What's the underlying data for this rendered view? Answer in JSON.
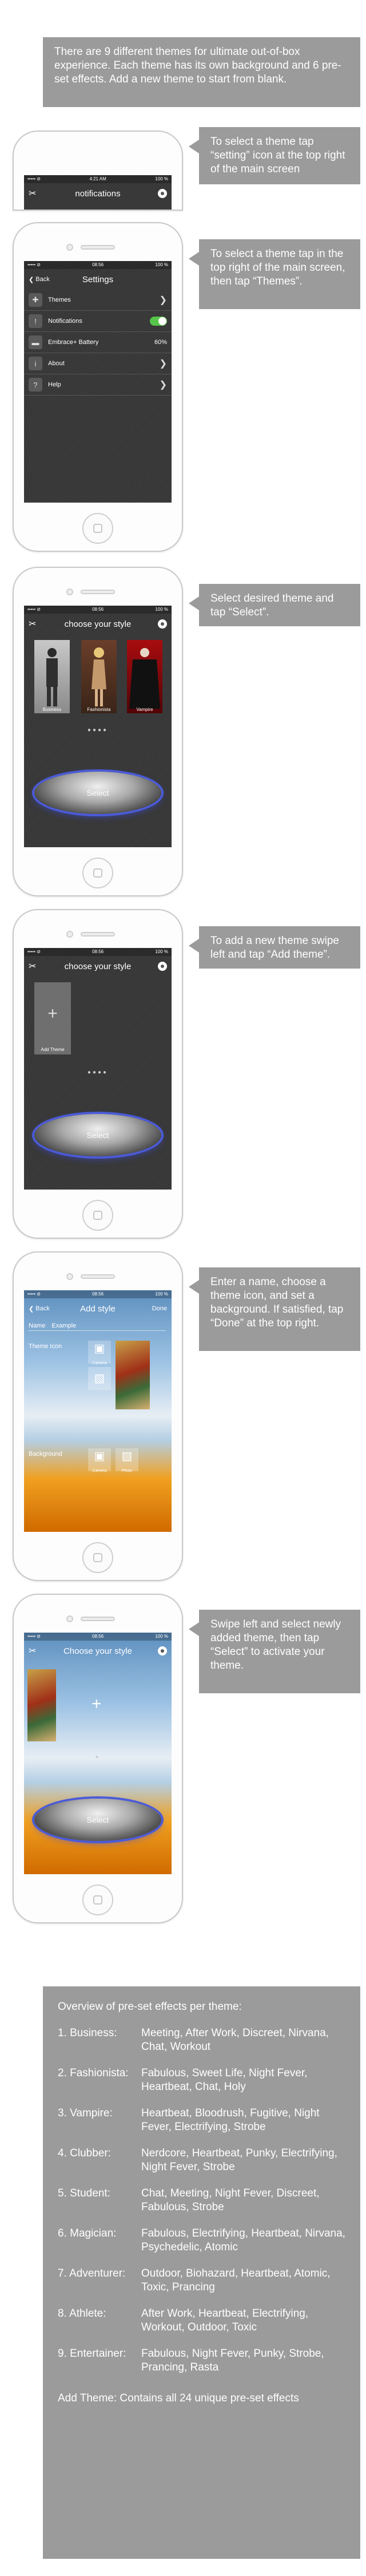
{
  "intro": "There are 9 different themes for ultimate out-of-box experience. Each theme has its own background and 6 pre-set effects. Add a new theme to start from blank.",
  "callouts": [
    "To select a theme tap “setting” icon at the top right of the main screen",
    "To select a theme tap   in the top right of the main screen, then tap “Themes”.",
    "Select desired theme and tap “Select”.",
    "To add a new theme swipe left and tap “Add theme”.",
    "Enter a name, choose a theme icon, and set a background. If satisfied, tap “Done” at the top right.",
    "Swipe left and select newly added theme, then tap “Select” to activate your theme."
  ],
  "status": {
    "carrier": "••••• ⊘",
    "time1": "4:21 AM",
    "time": "08:56",
    "battery": "100 %"
  },
  "screens": {
    "notifications": {
      "title": "notifications"
    },
    "settings": {
      "back": "Back",
      "title": "Settings",
      "items": [
        {
          "label": "Themes",
          "value": ""
        },
        {
          "label": "Notifications",
          "value": ""
        },
        {
          "label": "Embrace+ Battery",
          "value": "60%"
        },
        {
          "label": "About",
          "value": ""
        },
        {
          "label": "Help",
          "value": ""
        }
      ]
    },
    "choose": {
      "title": "choose your style",
      "themes": [
        "Business",
        "Fashionista",
        "Vampire"
      ],
      "select": "Select"
    },
    "add": {
      "title": "choose your style",
      "add_theme": "Add Theme",
      "select": "Select"
    },
    "addstyle": {
      "back": "Back",
      "title": "Add style",
      "done": "Done",
      "name_label": "Name",
      "name_value": "Example",
      "icon_label": "Theme Icon",
      "bg_label": "Background",
      "camera": "Camera",
      "photo": "Photo"
    },
    "final": {
      "title": "Choose your style",
      "select": "Select"
    }
  },
  "effects": {
    "heading": "Overview of pre-set effects per theme:",
    "themes": [
      {
        "name": "1. Business:",
        "effects": "Meeting, After Work, Discreet, Nirvana, Chat, Workout"
      },
      {
        "name": "2. Fashionista:",
        "effects": "Fabulous, Sweet Life, Night Fever, Heartbeat, Chat, Holy"
      },
      {
        "name": "3. Vampire:",
        "effects": "Heartbeat, Bloodrush, Fugitive, Night Fever, Electrifying, Strobe"
      },
      {
        "name": "4. Clubber:",
        "effects": "Nerdcore, Heartbeat, Punky, Electrifying, Night Fever, Strobe"
      },
      {
        "name": "5. Student:",
        "effects": "Chat, Meeting, Night Fever, Discreet, Fabulous, Strobe"
      },
      {
        "name": "6. Magician:",
        "effects": "Fabulous, Electrifying, Heartbeat, Nirvana, Psychedelic, Atomic"
      },
      {
        "name": "7. Adventurer:",
        "effects": "Outdoor, Biohazard, Heartbeat, Atomic, Toxic, Prancing"
      },
      {
        "name": "8. Athlete:",
        "effects": "After Work, Heartbeat, Electrifying, Workout, Outdoor, Toxic"
      },
      {
        "name": "9. Entertainer:",
        "effects": "Fabulous, Night Fever, Punky, Strobe, Prancing, Rasta"
      }
    ],
    "add_theme": "Add Theme: Contains all 24 unique pre-set effects"
  }
}
